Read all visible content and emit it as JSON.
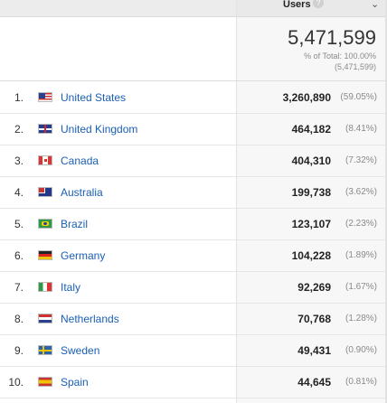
{
  "header": {
    "metric_label": "Users",
    "help_icon": "help-icon",
    "sort_icon": "chevron-down-icon"
  },
  "summary": {
    "total": "5,471,599",
    "pct_text": "% of Total: 100.00%",
    "pct_sub": "(5,471,599)"
  },
  "rows": [
    {
      "index": "1.",
      "country": "United States",
      "flag": "us-flag-icon",
      "value": "3,260,890",
      "pct": "(59.05%)"
    },
    {
      "index": "2.",
      "country": "United Kingdom",
      "flag": "uk-flag-icon",
      "value": "464,182",
      "pct": "(8.41%)"
    },
    {
      "index": "3.",
      "country": "Canada",
      "flag": "canada-flag-icon",
      "value": "404,310",
      "pct": "(7.32%)"
    },
    {
      "index": "4.",
      "country": "Australia",
      "flag": "australia-flag-icon",
      "value": "199,738",
      "pct": "(3.62%)"
    },
    {
      "index": "5.",
      "country": "Brazil",
      "flag": "brazil-flag-icon",
      "value": "123,107",
      "pct": "(2.23%)"
    },
    {
      "index": "6.",
      "country": "Germany",
      "flag": "germany-flag-icon",
      "value": "104,228",
      "pct": "(1.89%)"
    },
    {
      "index": "7.",
      "country": "Italy",
      "flag": "italy-flag-icon",
      "value": "92,269",
      "pct": "(1.67%)"
    },
    {
      "index": "8.",
      "country": "Netherlands",
      "flag": "netherlands-flag-icon",
      "value": "70,768",
      "pct": "(1.28%)"
    },
    {
      "index": "9.",
      "country": "Sweden",
      "flag": "sweden-flag-icon",
      "value": "49,431",
      "pct": "(0.90%)"
    },
    {
      "index": "10.",
      "country": "Spain",
      "flag": "spain-flag-icon",
      "value": "44,645",
      "pct": "(0.81%)"
    }
  ],
  "colors": {
    "link": "#1a5fb4",
    "muted": "#8a8a8a",
    "header_bg": "#e9e9e9",
    "right_column_bg": "#f7f7f7"
  }
}
